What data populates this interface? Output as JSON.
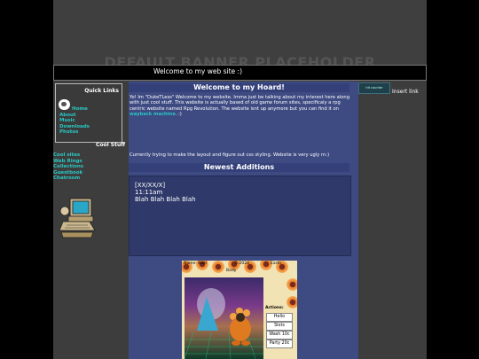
{
  "banner": {
    "placeholder": "DEFAULT BANNER PLACEHOLDER",
    "marquee": "Welcome to my web site :)"
  },
  "quick_links": {
    "title": "Quick Links",
    "items": [
      "Home",
      "About",
      "Music",
      "Downloads",
      "Photos"
    ]
  },
  "cool_stuff": {
    "title": "Cool Stuff",
    "items": [
      "Cool sites",
      "Web Rings",
      "Collections",
      "Guestbook",
      "Chatroom"
    ]
  },
  "main": {
    "welcome_title": "Welcome to my Hoard!",
    "intro_text": "Yo! Im \"DukeTLess\" Welcome to my website. Imma just be talking about my interest here along with just cool stuff. This website is actually based of old game forum sites, specificaly a rpg centric website named Rpg Revolution. The website isnt up anymore but you can find it on",
    "intro_link": "wayback machine",
    "intro_end": ". :)",
    "status": "Currently trying to make the layout and figure out css styling. Website is very ugly rn:)",
    "newest_title": "Newest Additions",
    "update": {
      "date": "[XX/XX/X]",
      "time": "11:11am",
      "text": "Blah Blah Blah Blah"
    }
  },
  "pet_widget": {
    "name": "Name: Kael",
    "born": "5-2024",
    "species": "Earth",
    "mood": "Body",
    "actions_label": "Actions:",
    "buttons": [
      "Hello",
      "Slots",
      "Wash 10c",
      "Party 20c"
    ]
  },
  "right_sidebar": {
    "badge": "hit counter",
    "insert_text": "Insert link"
  },
  "colors": {
    "link": "#29c7c2",
    "main_bg": "#3e4a82",
    "header_bg": "#34407a",
    "page_bg": "#3d3d3d"
  }
}
